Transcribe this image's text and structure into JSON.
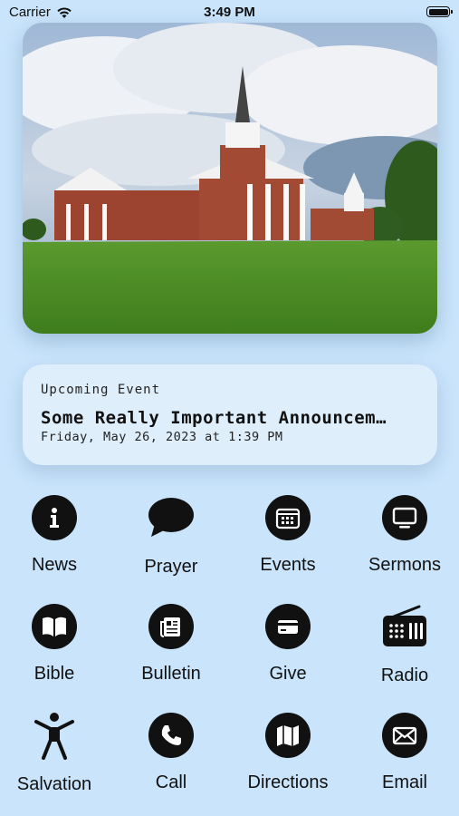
{
  "status_bar": {
    "carrier": "Carrier",
    "time": "3:49 PM"
  },
  "event": {
    "kicker": "Upcoming Event",
    "title": "Some Really Important Announcem…",
    "date": "Friday, May 26, 2023 at 1:39 PM"
  },
  "menu": {
    "items": [
      {
        "label": "News",
        "icon": "info-icon"
      },
      {
        "label": "Prayer",
        "icon": "speech-bubble-icon"
      },
      {
        "label": "Events",
        "icon": "calendar-icon"
      },
      {
        "label": "Sermons",
        "icon": "monitor-icon"
      },
      {
        "label": "Bible",
        "icon": "book-icon"
      },
      {
        "label": "Bulletin",
        "icon": "newspaper-icon"
      },
      {
        "label": "Give",
        "icon": "credit-card-icon"
      },
      {
        "label": "Radio",
        "icon": "radio-icon"
      },
      {
        "label": "Salvation",
        "icon": "person-arms-up-icon"
      },
      {
        "label": "Call",
        "icon": "phone-icon"
      },
      {
        "label": "Directions",
        "icon": "map-icon"
      },
      {
        "label": "Email",
        "icon": "envelope-icon"
      }
    ]
  }
}
